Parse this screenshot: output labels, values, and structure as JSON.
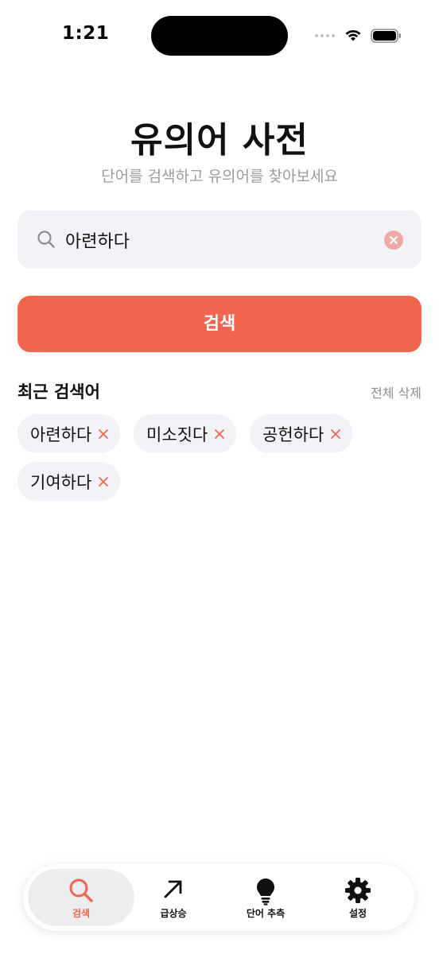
{
  "status_bar": {
    "time": "1:21"
  },
  "header": {
    "title": "유의어 사전",
    "subtitle": "단어를 검색하고 유의어를 찾아보세요"
  },
  "search": {
    "value": "아련하다",
    "icon": "search-icon",
    "clear_icon": "clear-circle-icon"
  },
  "search_button": {
    "label": "검색"
  },
  "recent": {
    "title": "최근 검색어",
    "clear_all": "전체 삭제",
    "items": [
      {
        "label": "아련하다"
      },
      {
        "label": "미소짓다"
      },
      {
        "label": "공헌하다"
      },
      {
        "label": "기여하다"
      }
    ]
  },
  "tabs": [
    {
      "label": "검색",
      "icon": "search-icon",
      "active": true
    },
    {
      "label": "급상승",
      "icon": "arrow-up-right-icon",
      "active": false
    },
    {
      "label": "단어 추측",
      "icon": "lightbulb-icon",
      "active": false
    },
    {
      "label": "설정",
      "icon": "gear-icon",
      "active": false
    }
  ],
  "colors": {
    "accent": "#f2664e",
    "field_bg": "#f2f2f7",
    "muted_text": "#8e8e93"
  }
}
